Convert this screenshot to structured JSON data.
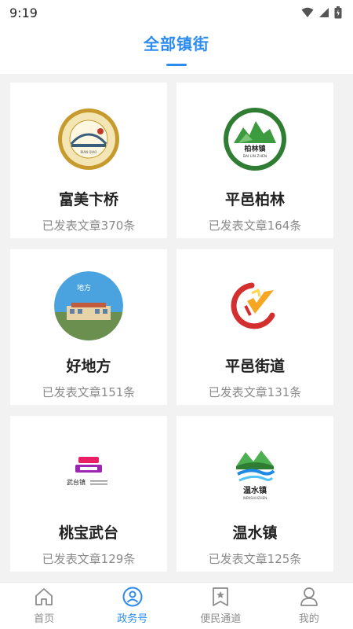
{
  "status": {
    "time": "9:19"
  },
  "header": {
    "title": "全部镇街"
  },
  "cards": [
    {
      "name": "富美卞桥",
      "count": "已发表文章370条",
      "logo_text": "BIAN QIAO"
    },
    {
      "name": "平邑柏林",
      "count": "已发表文章164条",
      "logo_text": "柏林镇",
      "logo_sub": "BAI LIN ZHEN"
    },
    {
      "name": "好地方",
      "count": "已发表文章151条",
      "logo_text": "地方"
    },
    {
      "name": "平邑街道",
      "count": "已发表文章131条"
    },
    {
      "name": "桃宝武台",
      "count": "已发表文章129条",
      "logo_text": "武台镇"
    },
    {
      "name": "温水镇",
      "count": "已发表文章125条",
      "logo_text": "温水镇",
      "logo_sub": "WENSHUIZHEN"
    }
  ],
  "tabs": [
    {
      "label": "首页",
      "icon": "home-icon"
    },
    {
      "label": "政务号",
      "icon": "government-account-icon",
      "active": true
    },
    {
      "label": "便民通道",
      "icon": "service-channel-icon"
    },
    {
      "label": "我的",
      "icon": "profile-icon"
    }
  ],
  "colors": {
    "accent": "#2d8cf0",
    "background": "#f2f2f2",
    "text": "#222222",
    "muted": "#8a8a8a"
  }
}
